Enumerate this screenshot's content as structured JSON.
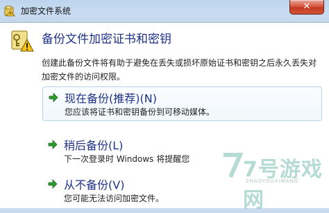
{
  "window": {
    "title": "加密文件系统",
    "close_symbol": "✕"
  },
  "dialog": {
    "heading": "备份文件加密证书和密钥",
    "description": "创建此备份文件将有助于避免在丢失或损坏原始证书和密钥之后永久丢失对加密文件的访问权限。"
  },
  "options": [
    {
      "title": "现在备份(推荐)(N)",
      "desc": "您应该将证书和密钥备份到可移动媒体。",
      "icon": "green-arrow-icon"
    },
    {
      "title": "稍后备份(L)",
      "desc": "下一次登录时 Windows 将提醒您",
      "icon": "green-arrow-icon"
    },
    {
      "title": "从不备份(V)",
      "desc": "您可能无法访问加密文件。",
      "icon": "green-arrow-icon"
    }
  ],
  "watermark": {
    "brand": "7号游戏网",
    "subtitle": "ZHAOYOUXIWANG"
  },
  "colors": {
    "heading": "#1e3287",
    "arrow": "#2e9a2e",
    "close": "#c9402a"
  }
}
